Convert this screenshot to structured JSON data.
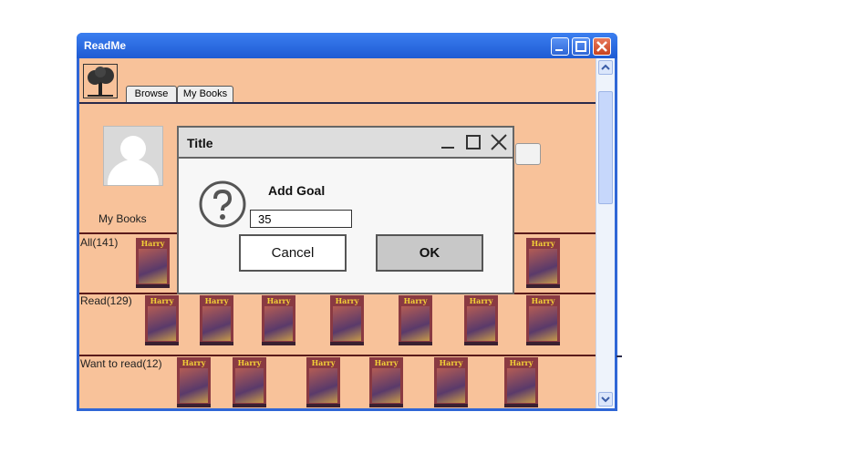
{
  "window": {
    "title": "ReadMe"
  },
  "tabs": [
    {
      "label": "Browse"
    },
    {
      "label": "My Books"
    }
  ],
  "profile": {
    "label": "My Books"
  },
  "rows": [
    {
      "label": "All(141)"
    },
    {
      "label": "Read(129)"
    },
    {
      "label": "Want to read(12)"
    }
  ],
  "book_cover": {
    "title": "Harry Potter"
  },
  "dialog": {
    "title": "Title",
    "heading": "Add Goal",
    "input_value": "35",
    "cancel_label": "Cancel",
    "ok_label": "OK",
    "icon": "question-icon"
  },
  "colors": {
    "client_bg": "#f8c29a",
    "titlebar": "#2f66d6",
    "dialog_bg": "#f7f7f7"
  }
}
